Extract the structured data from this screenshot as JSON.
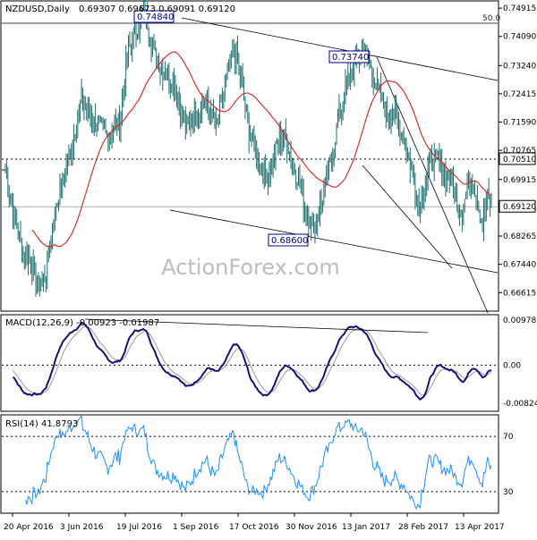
{
  "header": {
    "symbol": "NZDUSD,Daily",
    "ohlc": "0.69307 0.69673 0.69091 0.69120"
  },
  "watermark": "ActionForex.com",
  "colors": {
    "candles": "#1e6e6e",
    "sma": "#d62020",
    "macd": "#12127a",
    "signal": "#9a9a9a",
    "rsi": "#1e90ff",
    "trendline": "#000000",
    "grid": "#c8c8c8",
    "label_border": "#00008b"
  },
  "chart_data": [
    {
      "type": "candlestick",
      "panel": "price",
      "ylim": [
        0.661,
        0.751
      ],
      "y_ticks": [
        "0.74915",
        "0.74090",
        "0.73240",
        "0.72415",
        "0.71590",
        "0.70765",
        "0.69915",
        "0.69090",
        "0.68265",
        "0.67440",
        "0.66615"
      ],
      "x_ticks": [
        "20 Apr 2016",
        "3 Jun 2016",
        "19 Jul 2016",
        "1 Sep 2016",
        "17 Oct 2016",
        "30 Nov 2016",
        "13 Jan 2017",
        "28 Feb 2017",
        "13 Apr 2017"
      ],
      "horizontal_levels": [
        {
          "label": "0.70510",
          "value": 0.7051,
          "style": "dotted"
        },
        {
          "label": "0.69120",
          "value": 0.6912,
          "style": "current"
        }
      ],
      "fib_label": "50.0",
      "annotations": [
        {
          "label": "0.74840",
          "value": 0.7484
        },
        {
          "label": "0.73740",
          "value": 0.7374
        },
        {
          "label": "0.68600",
          "value": 0.686
        }
      ]
    },
    {
      "type": "line",
      "panel": "macd",
      "title": "MACD(12,26,9) -0.00923 -0.01987",
      "ylim": [
        -0.0098,
        0.0107
      ],
      "y_ticks": [
        "0.009781",
        "0.00",
        "-0.008244"
      ]
    },
    {
      "type": "line",
      "panel": "rsi",
      "title": "RSI(14) 41.8793",
      "ylim": [
        15,
        85
      ],
      "y_ticks": [
        "70",
        "30"
      ],
      "levels": [
        70,
        30
      ]
    }
  ]
}
